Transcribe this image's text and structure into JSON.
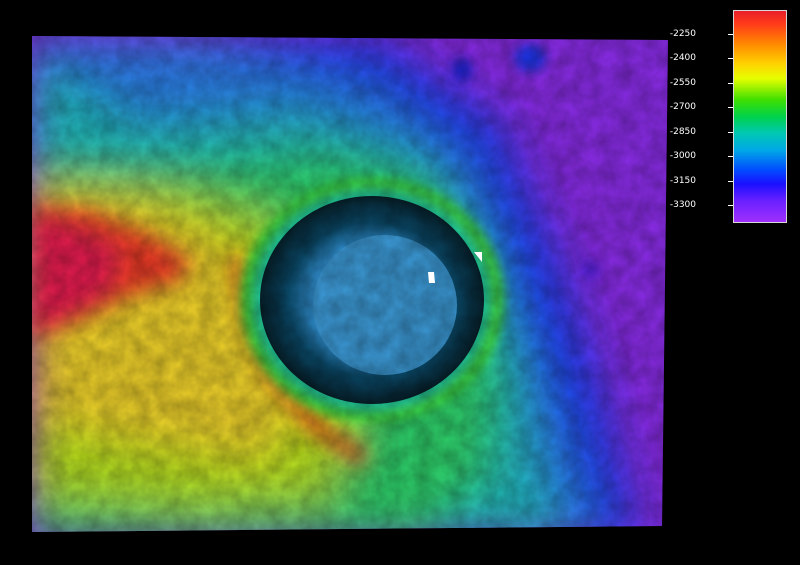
{
  "legend": {
    "ticks": [
      "-2250",
      "-2400",
      "-2550",
      "-2700",
      "-2850",
      "-3000",
      "-3150",
      "-3300"
    ]
  },
  "colors": {
    "background": "#000000",
    "colorbar_border": "#d8d8d8",
    "ramp": [
      "#e8202a",
      "#ff8c00",
      "#ffd200",
      "#40e000",
      "#00c8b4",
      "#0050ff",
      "#a030ff"
    ]
  }
}
